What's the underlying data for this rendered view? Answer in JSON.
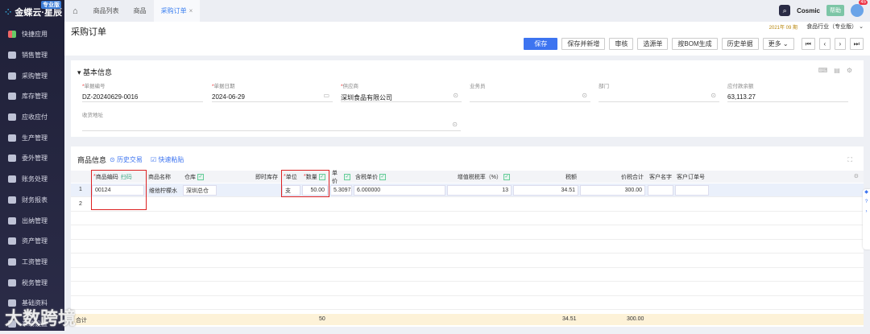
{
  "app": {
    "logo": "金蝶云·星辰",
    "edition": "专业版"
  },
  "sidebar": {
    "items": [
      "快捷应用",
      "销售管理",
      "采购管理",
      "库存管理",
      "应收应付",
      "生产管理",
      "委外管理",
      "账务处理",
      "财务报表",
      "出纳管理",
      "资产管理",
      "工资管理",
      "税务管理",
      "基础资料",
      "系统设置"
    ]
  },
  "tabs": {
    "home": "⌂",
    "items": [
      "商品列表",
      "商品",
      "采购订单"
    ],
    "close": "×"
  },
  "topbar": {
    "brand": "Cosmic",
    "help": "帮助",
    "badge": "45"
  },
  "header": {
    "title": "采购订单",
    "period": "2021年 09 期",
    "org": "食品行业（专业版）"
  },
  "toolbar": {
    "buttons": [
      "保存",
      "保存并新增",
      "审核",
      "选源单",
      "按BOM生成",
      "历史单据",
      "更多 ⌄"
    ],
    "nav": [
      "⏮",
      "‹",
      "›",
      "⏭"
    ]
  },
  "basic": {
    "title": "基本信息",
    "fields": [
      {
        "label": "单据编号",
        "required": "*",
        "value": "DZ-20240629-0016"
      },
      {
        "label": "单据日期",
        "required": "*",
        "value": "2024-06-29"
      },
      {
        "label": "供应商",
        "required": "*",
        "value": "深圳食品有限公司"
      },
      {
        "label": "业务员",
        "required": "",
        "value": ""
      },
      {
        "label": "部门",
        "required": "",
        "value": ""
      },
      {
        "label": "应付款余额",
        "required": "",
        "value": "63,113.27"
      },
      {
        "label": "收货地址",
        "required": "",
        "value": ""
      }
    ]
  },
  "goods": {
    "title": "商品信息",
    "links": [
      "历史交易",
      "快速粘贴"
    ],
    "scan": "扫码",
    "columns": [
      "商品编码",
      "商品名称",
      "仓库",
      "即时库存",
      "单位",
      "数量",
      "单价",
      "含税单价",
      "增值税税率（%）",
      "税额",
      "价税合计",
      "客户名字",
      "客户订单号"
    ],
    "rows": [
      {
        "index": "1",
        "code": "00124",
        "name": "维他柠檬水",
        "warehouse": "深圳总仓",
        "unit": "支",
        "qty": "50.00",
        "price": "5.309735",
        "tax_price": "6.000000",
        "tax_rate": "13",
        "tax": "34.51",
        "total": "300.00"
      },
      {
        "index": "2"
      }
    ],
    "summary": {
      "label": "合计",
      "qty": "50",
      "tax": "34.51",
      "total": "300.00"
    }
  },
  "watermark": "大数跨境"
}
